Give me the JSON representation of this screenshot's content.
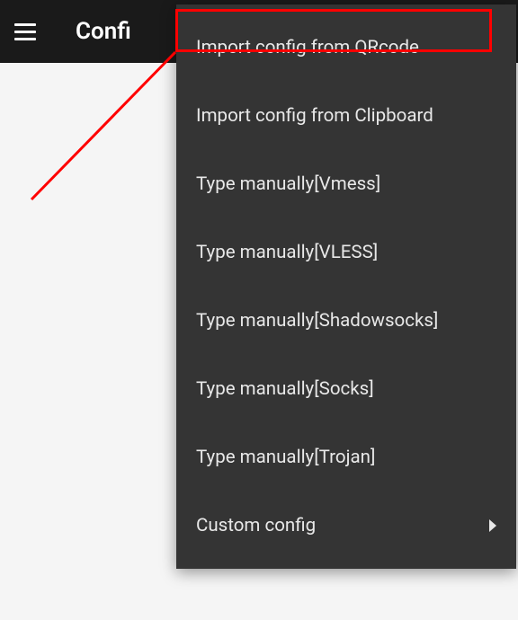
{
  "header": {
    "title": "Confi"
  },
  "menu": {
    "items": [
      {
        "label": "Import config from QRcode",
        "highlighted": true,
        "hasChevron": false
      },
      {
        "label": "Import config from Clipboard",
        "highlighted": false,
        "hasChevron": false
      },
      {
        "label": "Type manually[Vmess]",
        "highlighted": false,
        "hasChevron": false
      },
      {
        "label": "Type manually[VLESS]",
        "highlighted": false,
        "hasChevron": false
      },
      {
        "label": "Type manually[Shadowsocks]",
        "highlighted": false,
        "hasChevron": false
      },
      {
        "label": "Type manually[Socks]",
        "highlighted": false,
        "hasChevron": false
      },
      {
        "label": "Type manually[Trojan]",
        "highlighted": false,
        "hasChevron": false
      },
      {
        "label": "Custom config",
        "highlighted": false,
        "hasChevron": true
      }
    ]
  },
  "annotation": {
    "highlightColor": "#ff0000"
  }
}
